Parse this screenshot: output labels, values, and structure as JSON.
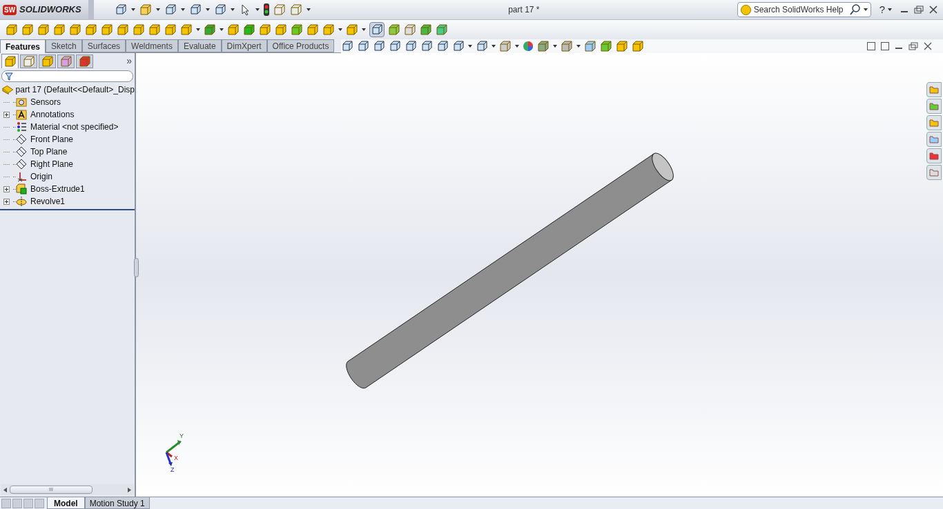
{
  "app": {
    "logo_badge": "SW",
    "logo_text": "SOLIDWORKS"
  },
  "window": {
    "title": "part 17 *"
  },
  "search": {
    "placeholder": "Search SolidWorks Help"
  },
  "help_button": "?",
  "command_tabs": [
    {
      "label": "Features",
      "selected": true
    },
    {
      "label": "Sketch",
      "selected": false
    },
    {
      "label": "Surfaces",
      "selected": false
    },
    {
      "label": "Weldments",
      "selected": false
    },
    {
      "label": "Evaluate",
      "selected": false
    },
    {
      "label": "DimXpert",
      "selected": false
    },
    {
      "label": "Office Products",
      "selected": false
    }
  ],
  "panel_tabs": [
    {
      "selected": true
    },
    {
      "selected": false
    },
    {
      "selected": false
    },
    {
      "selected": false
    },
    {
      "selected": false
    }
  ],
  "panel_more": "»",
  "tree": {
    "root": "part 17  (Default<<Default>_Disp",
    "items": [
      {
        "label": "Sensors",
        "kind": "sensor",
        "expandable": false
      },
      {
        "label": "Annotations",
        "kind": "annotation",
        "expandable": true
      },
      {
        "label": "Material <not specified>",
        "kind": "material",
        "expandable": false
      },
      {
        "label": "Front Plane",
        "kind": "plane",
        "expandable": false
      },
      {
        "label": "Top Plane",
        "kind": "plane",
        "expandable": false
      },
      {
        "label": "Right Plane",
        "kind": "plane",
        "expandable": false
      },
      {
        "label": "Origin",
        "kind": "origin",
        "expandable": false
      },
      {
        "label": "Boss-Extrude1",
        "kind": "extrude",
        "expandable": true
      },
      {
        "label": "Revolve1",
        "kind": "revolve",
        "expandable": true
      }
    ]
  },
  "triad": {
    "x": "X",
    "y": "Y",
    "z": "Z"
  },
  "scroll_grip": "III",
  "bottom_tabs": [
    {
      "label": "Model",
      "selected": true
    },
    {
      "label": "Motion Study 1",
      "selected": false
    }
  ]
}
